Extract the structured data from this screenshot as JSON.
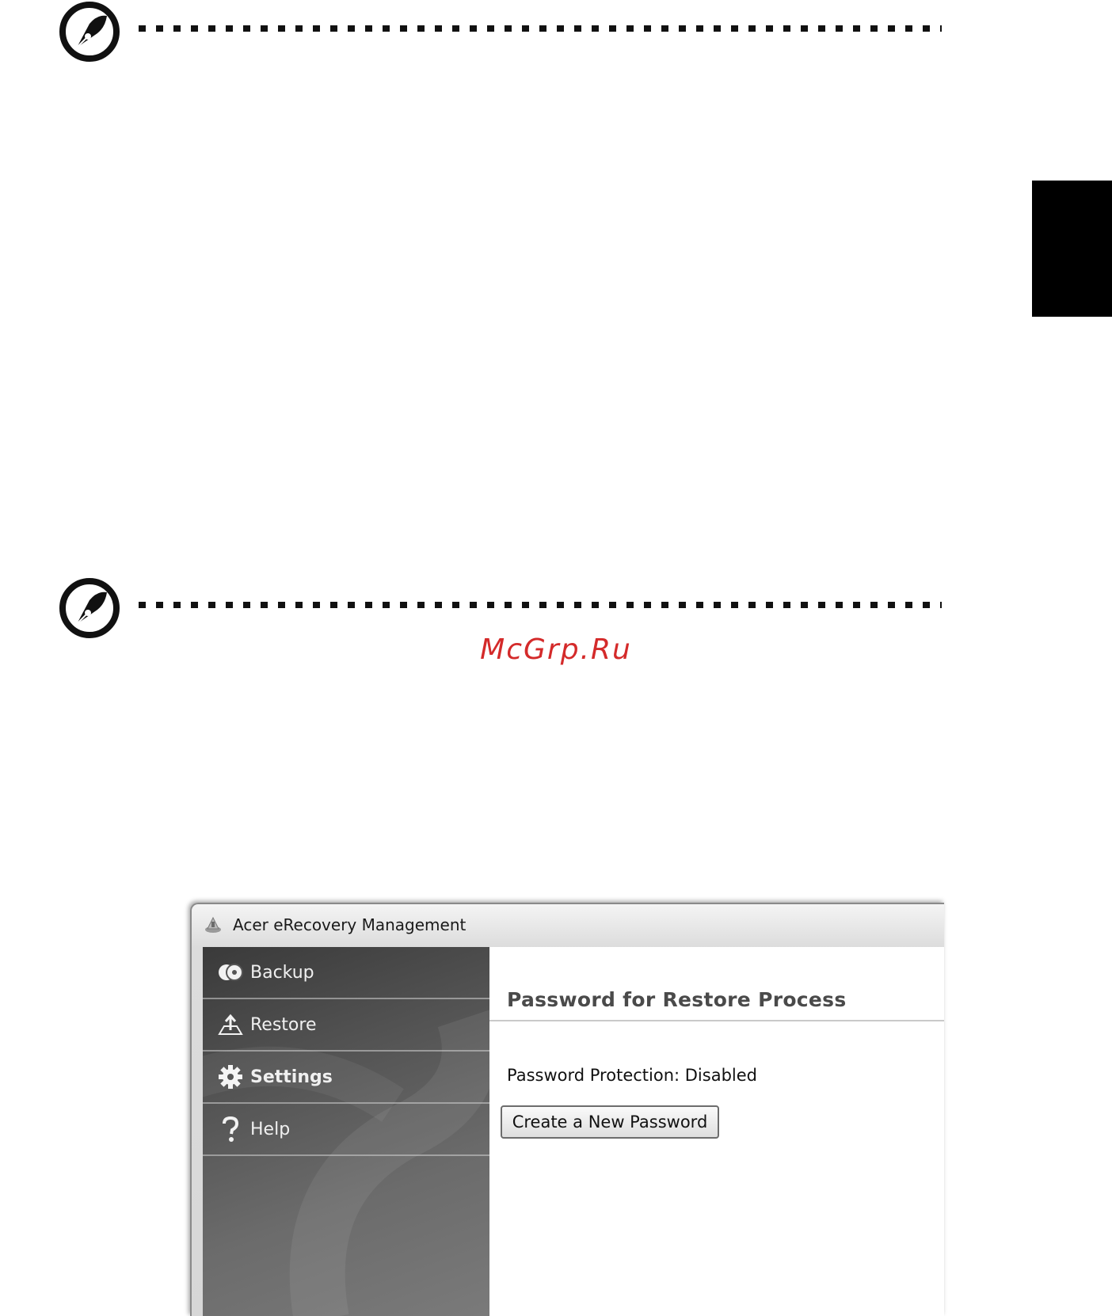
{
  "watermark": "McGrp.Ru",
  "window": {
    "title": "Acer eRecovery Management"
  },
  "sidebar": {
    "items": [
      {
        "label": "Backup",
        "icon": "disc-icon",
        "active": false
      },
      {
        "label": "Restore",
        "icon": "restore-icon",
        "active": false
      },
      {
        "label": "Settings",
        "icon": "gear-icon",
        "active": true
      },
      {
        "label": "Help",
        "icon": "question-icon",
        "active": false
      }
    ]
  },
  "content": {
    "section_title": "Password for Restore Process",
    "status": "Password Protection: Disabled",
    "create_button": "Create a New Password"
  }
}
